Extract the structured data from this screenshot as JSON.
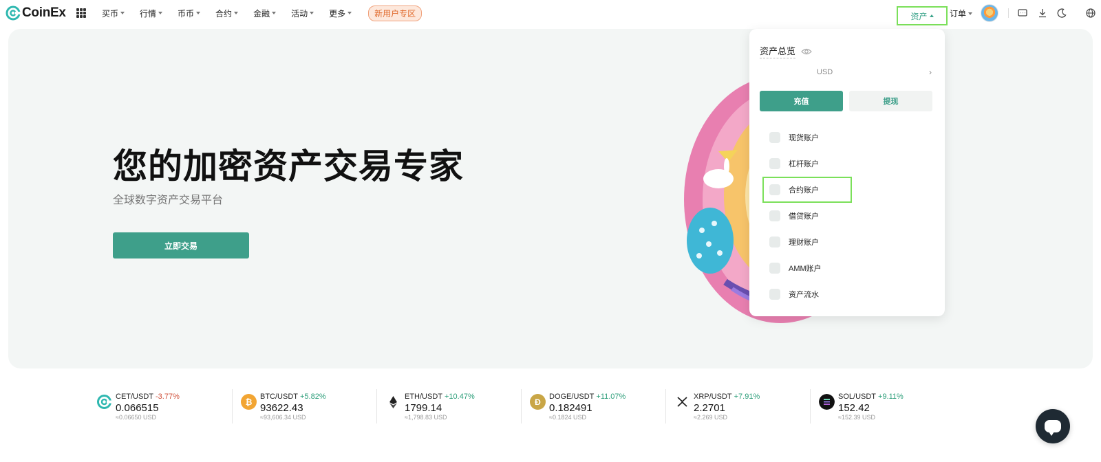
{
  "brand": {
    "name": "CoinEx"
  },
  "nav": {
    "items": [
      {
        "label": "买币"
      },
      {
        "label": "行情"
      },
      {
        "label": "币币"
      },
      {
        "label": "合约"
      },
      {
        "label": "金融"
      },
      {
        "label": "活动"
      },
      {
        "label": "更多"
      }
    ],
    "promo": "新用户专区",
    "assets": "资产",
    "orders": "订单"
  },
  "hero": {
    "title": "您的加密资产交易专家",
    "subtitle": "全球数字资产交易平台",
    "cta": "立即交易"
  },
  "assets_menu": {
    "title": "资产总览",
    "currency": "USD",
    "deposit": "充值",
    "withdraw": "提现",
    "items": [
      {
        "label": "现货账户",
        "icon": "coins-icon"
      },
      {
        "label": "杠杆账户",
        "icon": "percent-icon"
      },
      {
        "label": "合约账户",
        "icon": "contract-icon"
      },
      {
        "label": "借贷账户",
        "icon": "loan-icon"
      },
      {
        "label": "理财账户",
        "icon": "wealth-icon"
      },
      {
        "label": "AMM账户",
        "icon": "amm-icon"
      },
      {
        "label": "资产流水",
        "icon": "ledger-icon"
      }
    ]
  },
  "ticker": [
    {
      "pair": "CET/USDT",
      "change": "-3.77%",
      "price": "0.066515",
      "usd": "≈0.06650 USD",
      "trend": "down",
      "icon": "coinex-icon",
      "color": "#2fb8b0"
    },
    {
      "pair": "BTC/USDT",
      "change": "+5.82%",
      "price": "93622.43",
      "usd": "≈93,606.34 USD",
      "trend": "up",
      "icon": "bitcoin-icon",
      "color": "#f2a533"
    },
    {
      "pair": "ETH/USDT",
      "change": "+10.47%",
      "price": "1799.14",
      "usd": "≈1,798.83 USD",
      "trend": "up",
      "icon": "ethereum-icon",
      "color": "#ffffff"
    },
    {
      "pair": "DOGE/USDT",
      "change": "+11.07%",
      "price": "0.182491",
      "usd": "≈0.1824 USD",
      "trend": "up",
      "icon": "dogecoin-icon",
      "color": "#c9a646"
    },
    {
      "pair": "XRP/USDT",
      "change": "+7.91%",
      "price": "2.2701",
      "usd": "≈2.269 USD",
      "trend": "up",
      "icon": "xrp-icon",
      "color": "#ffffff"
    },
    {
      "pair": "SOL/USDT",
      "change": "+9.11%",
      "price": "152.42",
      "usd": "≈152.39 USD",
      "trend": "up",
      "icon": "solana-icon",
      "color": "#111111"
    }
  ],
  "colors": {
    "accent": "#3e9f8a",
    "up": "#2a9d78",
    "down": "#d0503a",
    "highlight": "#7be05a"
  }
}
